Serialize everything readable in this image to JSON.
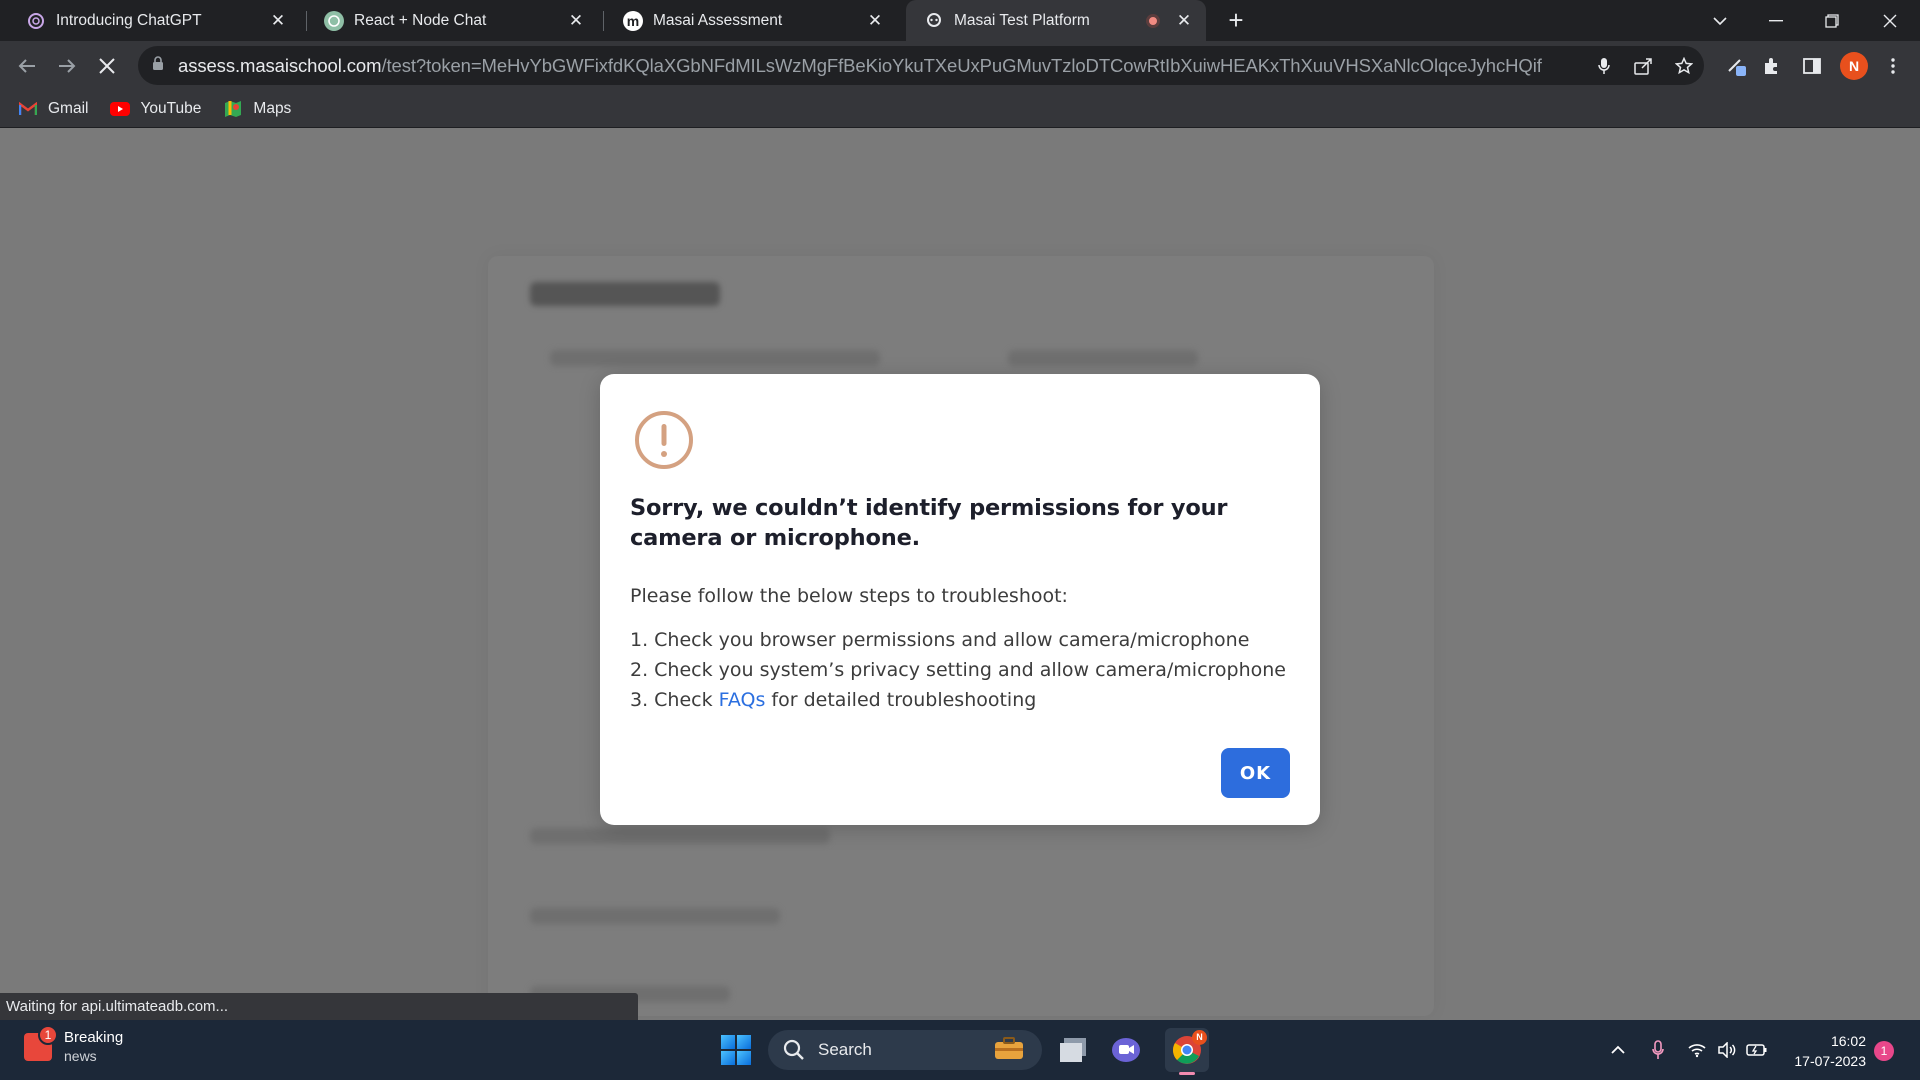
{
  "browser": {
    "tabs": [
      {
        "title": "Introducing ChatGPT",
        "active": false
      },
      {
        "title": "React + Node Chat",
        "active": false
      },
      {
        "title": "Masai Assessment",
        "active": false
      },
      {
        "title": "Masai Test Platform",
        "active": true,
        "recording": true
      }
    ],
    "address": {
      "host": "assess.masaischool.com",
      "path": "/test?token=MeHvYbGWFixfdKQlaXGbNFdMILsWzMgFfBeKioYkuTXeUxPuGMuvTzloDTCowRtIbXuiwHEAKxThXuuVHSXaNlcOlqceJyhcHQif"
    },
    "profile_initial": "N",
    "bookmarks": [
      {
        "label": "Gmail",
        "icon": "gmail-icon"
      },
      {
        "label": "YouTube",
        "icon": "youtube-icon"
      },
      {
        "label": "Maps",
        "icon": "maps-icon"
      }
    ],
    "status_text": "Waiting for api.ultimateadb.com..."
  },
  "modal": {
    "icon": "warning-icon",
    "icon_color": "#d4a181",
    "title": "Sorry, we couldn’t identify permissions for your camera or microphone.",
    "intro": "Please follow the below steps to troubleshoot:",
    "steps": [
      {
        "text": "1. Check you browser permissions and allow camera/microphone"
      },
      {
        "text": "2. Check you system’s privacy setting and allow camera/microphone"
      },
      {
        "prefix": "3. Check ",
        "link": "FAQs",
        "suffix": " for detailed troubleshooting"
      }
    ],
    "ok_label": "OK",
    "accent": "#2d6ddd"
  },
  "taskbar": {
    "news": {
      "title": "Breaking",
      "subtitle": "news",
      "badge": "1"
    },
    "search_label": "Search",
    "time": "16:02",
    "date": "17-07-2023",
    "notification_count": "1"
  }
}
